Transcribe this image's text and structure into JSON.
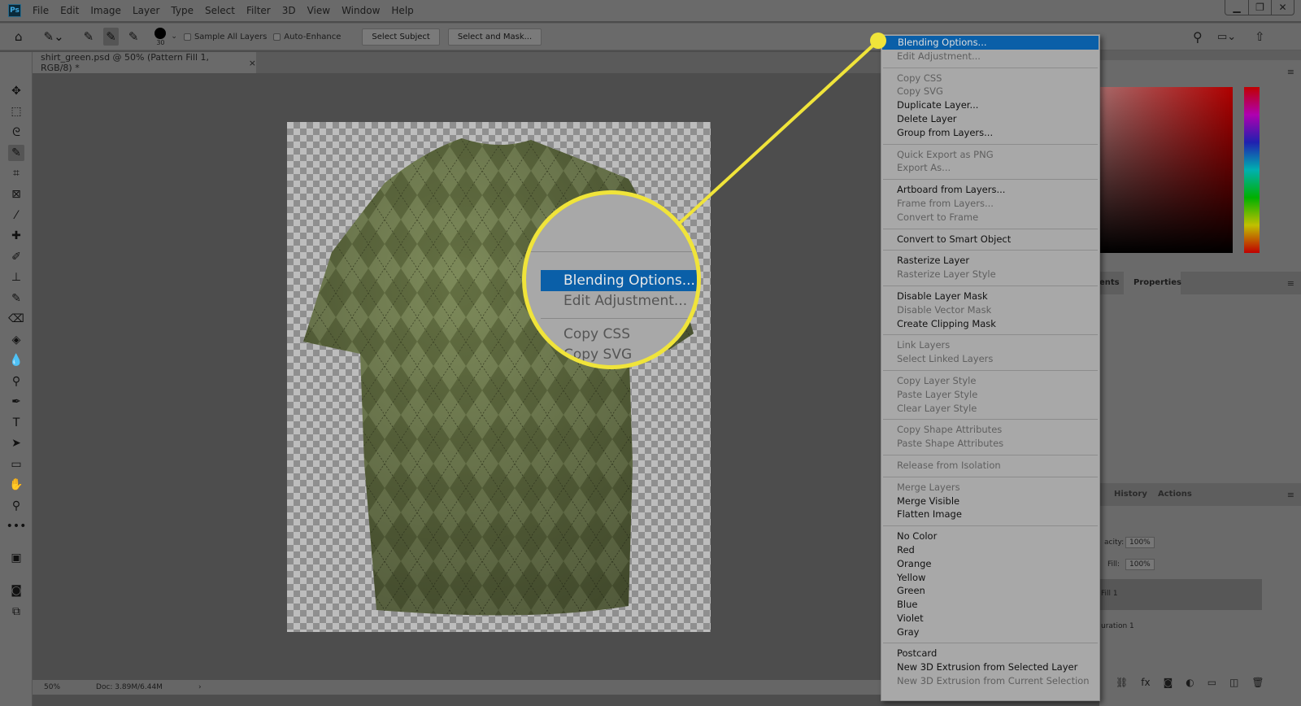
{
  "app": {
    "logo": "Ps"
  },
  "menubar": [
    "File",
    "Edit",
    "Image",
    "Layer",
    "Type",
    "Select",
    "Filter",
    "3D",
    "View",
    "Window",
    "Help"
  ],
  "window_controls": {
    "minimize": "▁",
    "restore": "❐",
    "close": "✕"
  },
  "options_bar": {
    "brush_size": "30",
    "sample_all_layers": "Sample All Layers",
    "auto_enhance": "Auto-Enhance",
    "select_subject": "Select Subject",
    "select_and_mask": "Select and Mask..."
  },
  "document_tab": {
    "title": "shirt_green.psd @ 50% (Pattern Fill 1, RGB/8) *",
    "close": "×"
  },
  "status": {
    "zoom": "50%",
    "doc": "Doc: 3.89M/6.44M",
    "arrow": "›"
  },
  "right_panel": {
    "tab_adjust_partial": "ents",
    "tab_properties": "Properties",
    "tab_history": "History",
    "tab_actions": "Actions",
    "opacity_label": "acity:",
    "opacity_value": "100%",
    "fill_label": "Fill:",
    "fill_value": "100%",
    "layer1": "Fill 1",
    "layer2": "uration 1"
  },
  "context_menu": [
    [
      {
        "label": "Blending Options...",
        "state": "highlighted"
      },
      {
        "label": "Edit Adjustment...",
        "state": "disabled"
      }
    ],
    [
      {
        "label": "Copy CSS",
        "state": "disabled"
      },
      {
        "label": "Copy SVG",
        "state": "disabled"
      },
      {
        "label": "Duplicate Layer...",
        "state": "enabled"
      },
      {
        "label": "Delete Layer",
        "state": "enabled"
      },
      {
        "label": "Group from Layers...",
        "state": "enabled"
      }
    ],
    [
      {
        "label": "Quick Export as PNG",
        "state": "disabled"
      },
      {
        "label": "Export As...",
        "state": "disabled"
      }
    ],
    [
      {
        "label": "Artboard from Layers...",
        "state": "enabled"
      },
      {
        "label": "Frame from Layers...",
        "state": "disabled"
      },
      {
        "label": "Convert to Frame",
        "state": "disabled"
      }
    ],
    [
      {
        "label": "Convert to Smart Object",
        "state": "enabled"
      }
    ],
    [
      {
        "label": "Rasterize Layer",
        "state": "enabled"
      },
      {
        "label": "Rasterize Layer Style",
        "state": "disabled"
      }
    ],
    [
      {
        "label": "Disable Layer Mask",
        "state": "enabled"
      },
      {
        "label": "Disable Vector Mask",
        "state": "disabled"
      },
      {
        "label": "Create Clipping Mask",
        "state": "enabled"
      }
    ],
    [
      {
        "label": "Link Layers",
        "state": "disabled"
      },
      {
        "label": "Select Linked Layers",
        "state": "disabled"
      }
    ],
    [
      {
        "label": "Copy Layer Style",
        "state": "disabled"
      },
      {
        "label": "Paste Layer Style",
        "state": "disabled"
      },
      {
        "label": "Clear Layer Style",
        "state": "disabled"
      }
    ],
    [
      {
        "label": "Copy Shape Attributes",
        "state": "disabled"
      },
      {
        "label": "Paste Shape Attributes",
        "state": "disabled"
      }
    ],
    [
      {
        "label": "Release from Isolation",
        "state": "disabled"
      }
    ],
    [
      {
        "label": "Merge Layers",
        "state": "disabled"
      },
      {
        "label": "Merge Visible",
        "state": "enabled"
      },
      {
        "label": "Flatten Image",
        "state": "enabled"
      }
    ],
    [
      {
        "label": "No Color",
        "state": "enabled"
      },
      {
        "label": "Red",
        "state": "enabled"
      },
      {
        "label": "Orange",
        "state": "enabled"
      },
      {
        "label": "Yellow",
        "state": "enabled"
      },
      {
        "label": "Green",
        "state": "enabled"
      },
      {
        "label": "Blue",
        "state": "enabled"
      },
      {
        "label": "Violet",
        "state": "enabled"
      },
      {
        "label": "Gray",
        "state": "enabled"
      }
    ],
    [
      {
        "label": "Postcard",
        "state": "enabled"
      },
      {
        "label": "New 3D Extrusion from Selected Layer",
        "state": "enabled"
      },
      {
        "label": "New 3D Extrusion from Current Selection",
        "state": "disabled"
      }
    ]
  ],
  "callout": {
    "items": [
      "Blending Options...",
      "Edit Adjustment...",
      "Copy CSS",
      "Copy SVG"
    ],
    "color": "#f0e43a"
  },
  "colors": {
    "highlight": "#0a5fa8",
    "callout": "#f0e43a",
    "shirt": "#6e7a4a"
  }
}
